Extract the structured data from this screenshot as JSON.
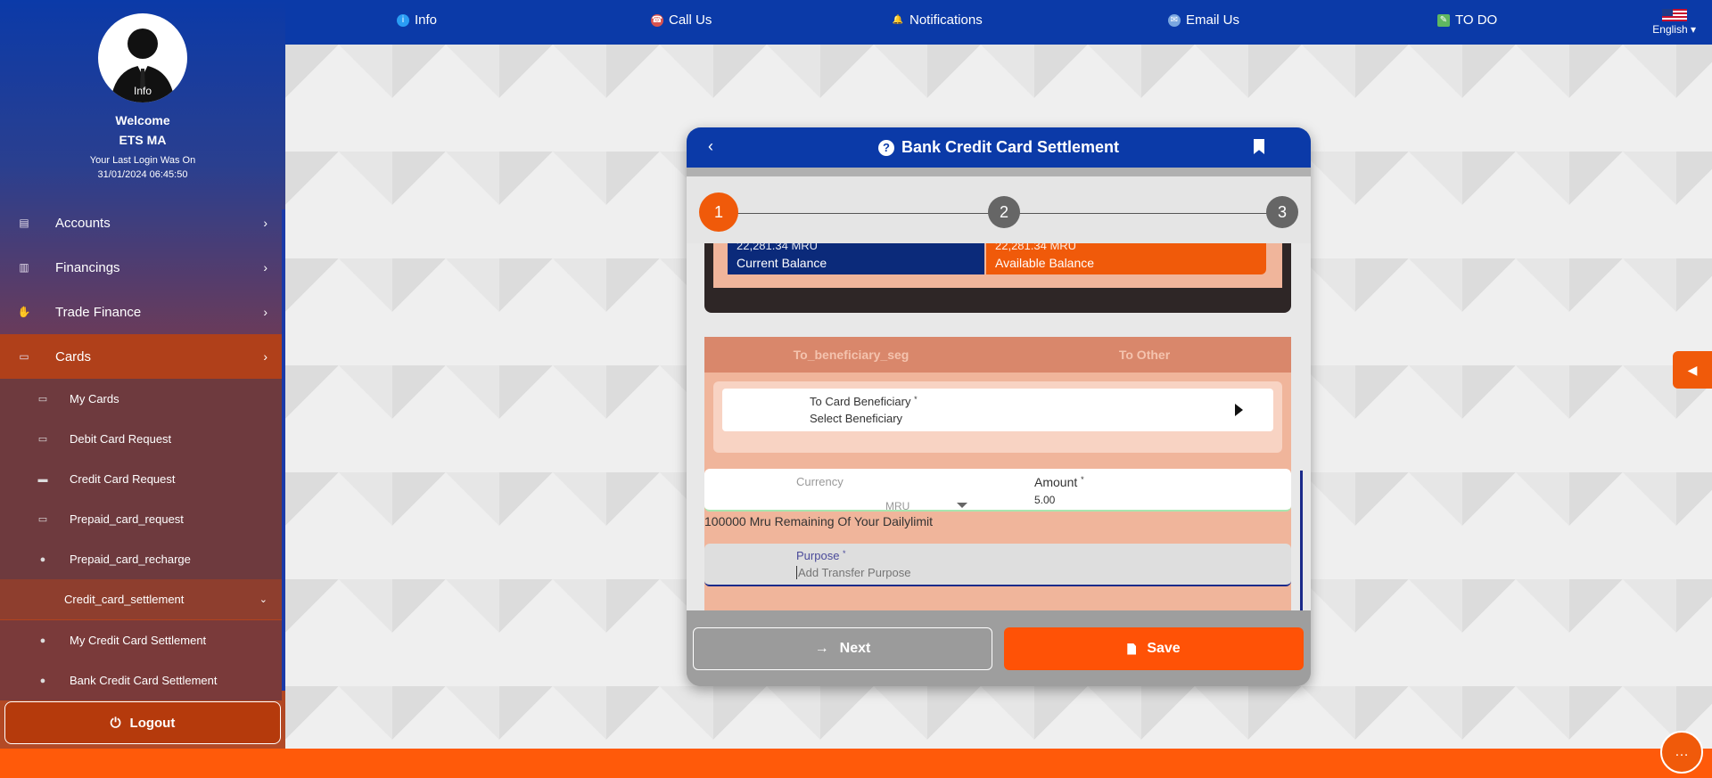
{
  "profile": {
    "avatar_label": "Info",
    "welcome": "Welcome",
    "name": "ETS MA",
    "last_login_label": "Your Last Login Was On",
    "last_login_time": "31/01/2024 06:45:50"
  },
  "sidebar": {
    "items": [
      {
        "label": "Accounts",
        "icon": "accounts-icon"
      },
      {
        "label": "Financings",
        "icon": "chart-icon"
      },
      {
        "label": "Trade Finance",
        "icon": "handshake-icon"
      },
      {
        "label": "Cards",
        "icon": "cards-icon"
      }
    ],
    "sub_items": [
      {
        "label": "My Cards",
        "icon": "card-icon"
      },
      {
        "label": "Debit Card Request",
        "icon": "card-icon"
      },
      {
        "label": "Credit Card Request",
        "icon": "credit-card-icon"
      },
      {
        "label": "Prepaid_card_request",
        "icon": "card-icon"
      },
      {
        "label": "Prepaid_card_recharge",
        "icon": "question-icon"
      },
      {
        "label": "Credit_card_settlement",
        "icon": "chevron-down-icon"
      },
      {
        "label": "My Credit Card Settlement",
        "icon": "question-icon"
      },
      {
        "label": "Bank Credit Card Settlement",
        "icon": "question-icon"
      }
    ],
    "logout": "Logout"
  },
  "topbar": {
    "items": [
      "Info",
      "Call Us",
      "Notifications",
      "Email Us",
      "TO DO"
    ],
    "language": "English"
  },
  "modal": {
    "title": "Bank Credit Card Settlement",
    "steps": [
      "1",
      "2",
      "3"
    ],
    "current_balance_value": "22,281.34 MRU",
    "current_balance_label": "Current Balance",
    "available_balance_value": "22,281.34 MRU",
    "available_balance_label": "Available Balance",
    "segments": [
      "To_beneficiary_seg",
      "To Other"
    ],
    "beneficiary_label": "To Card Beneficiary",
    "beneficiary_value": "Select Beneficiary",
    "currency_label": "Currency",
    "currency_value": "MRU",
    "amount_label": "Amount",
    "amount_value": "5.00",
    "limit_text": "100000 Mru Remaining Of Your Dailylimit",
    "purpose_label": "Purpose",
    "purpose_placeholder": "Add Transfer Purpose",
    "next_label": "Next",
    "save_label": "Save"
  },
  "colors": {
    "brand_blue": "#0b3aa8",
    "accent_orange": "#f05a0a"
  }
}
